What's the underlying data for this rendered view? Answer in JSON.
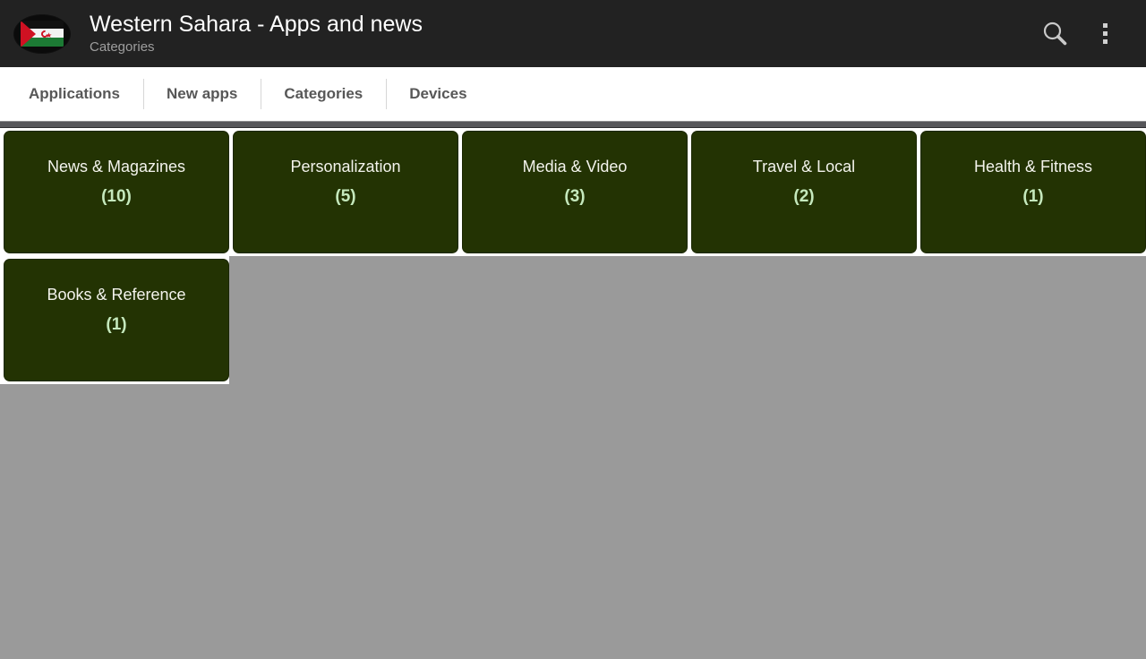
{
  "appbar": {
    "icon_name": "western-sahara-flag",
    "title": "Western Sahara - Apps and news",
    "subtitle": "Categories",
    "search_icon": "search-icon",
    "overflow_icon": "overflow-menu-icon",
    "background": "#222222",
    "title_color": "#ffffff",
    "subtitle_color": "#9e9e9e"
  },
  "tabs": [
    {
      "label": "Applications"
    },
    {
      "label": "New apps"
    },
    {
      "label": "Categories"
    },
    {
      "label": "Devices"
    }
  ],
  "colors": {
    "tile_background": "#233303",
    "tile_label": "#f3f3ec",
    "tile_count": "#c5e9bd",
    "page_background": "#9a9a9a",
    "tab_bar_background": "#ffffff",
    "tab_label": "#575757",
    "divider": "#56565a"
  },
  "categories": [
    {
      "label": "News & Magazines",
      "count": "(10)"
    },
    {
      "label": "Personalization",
      "count": "(5)"
    },
    {
      "label": "Media & Video",
      "count": "(3)"
    },
    {
      "label": "Travel & Local",
      "count": "(2)"
    },
    {
      "label": "Health & Fitness",
      "count": "(1)"
    },
    {
      "label": "Books & Reference",
      "count": "(1)"
    }
  ]
}
